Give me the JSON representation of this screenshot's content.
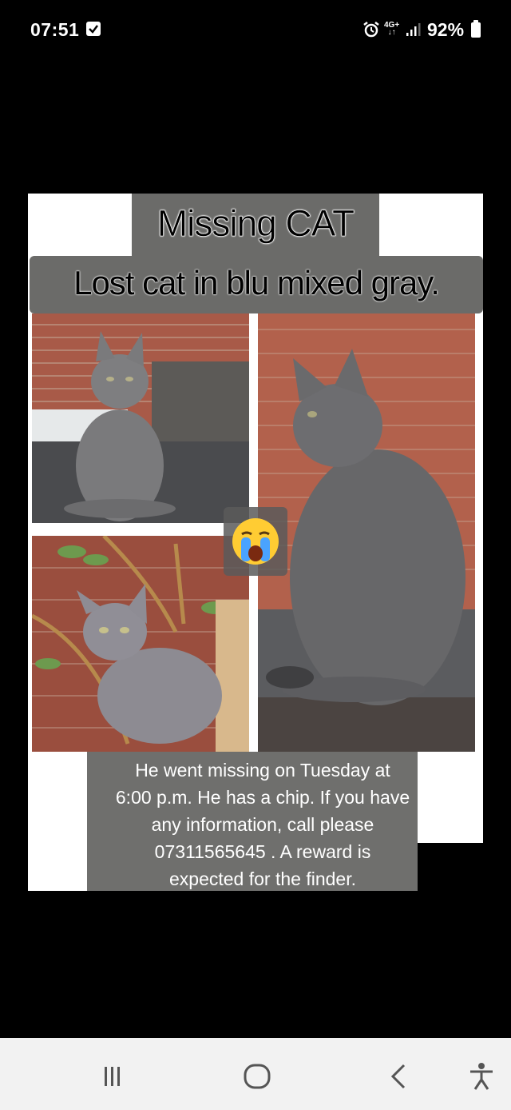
{
  "status_bar": {
    "time": "07:51",
    "network": "4G+",
    "battery": "92%"
  },
  "poster": {
    "title": "Missing CAT",
    "subtitle": "Lost cat in blu mixed gray.",
    "emoji": "crying-face",
    "info_lines": [
      "He went missing on Tuesday at",
      "6:00 p.m. He has a chip. If you have",
      "any information, call please",
      "07311565645 . A reward is",
      "expected for the finder."
    ]
  },
  "nav_bar": {
    "icons": [
      "recent-apps-icon",
      "home-icon",
      "back-icon",
      "accessibility-icon"
    ]
  },
  "colors": {
    "background": "#000000",
    "label_box": "#6b6b69",
    "nav_bar": "#f2f2f2"
  }
}
